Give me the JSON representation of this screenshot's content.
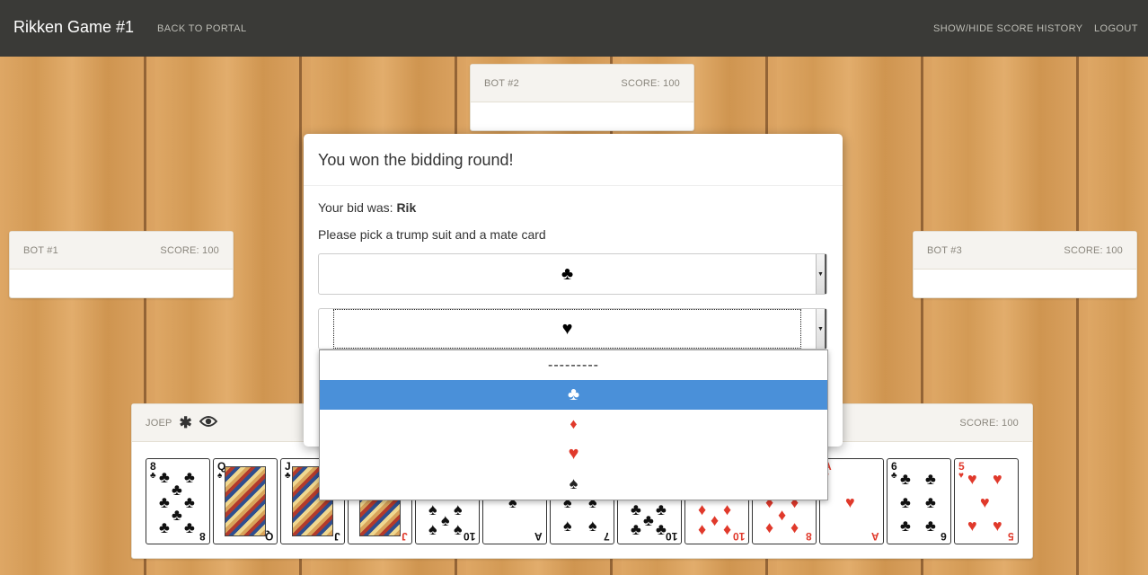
{
  "navbar": {
    "title": "Rikken Game #1",
    "back_label": "BACK TO PORTAL",
    "history_label": "SHOW/HIDE SCORE HISTORY",
    "logout_label": "LOGOUT"
  },
  "bots": {
    "bot1": {
      "name": "BOT #1",
      "score": "SCORE: 100"
    },
    "bot2": {
      "name": "BOT #2",
      "score": "SCORE: 100"
    },
    "bot3": {
      "name": "BOT #3",
      "score": "SCORE: 100"
    }
  },
  "player": {
    "name": "JOEP",
    "score": "SCORE: 100",
    "icons": [
      "asterisk-icon",
      "eye-icon"
    ]
  },
  "modal": {
    "title": "You won the bidding round!",
    "bid_prefix": "Your bid was: ",
    "bid_value": "Rik",
    "instruction": "Please pick a trump suit and a mate card",
    "trump_value": "♣",
    "mate_value": "♥"
  },
  "dropdown": {
    "options": [
      "---------",
      "♣",
      "♦",
      "♥",
      "♠"
    ],
    "selected_index": 1
  },
  "hand": [
    {
      "rank": "8",
      "suit": "♣",
      "color": "black"
    },
    {
      "rank": "Q",
      "suit": "♠",
      "color": "black"
    },
    {
      "rank": "J",
      "suit": "♣",
      "color": "black"
    },
    {
      "rank": "J",
      "suit": "♦",
      "color": "red"
    },
    {
      "rank": "10",
      "suit": "♠",
      "color": "black"
    },
    {
      "rank": "A",
      "suit": "♠",
      "color": "black"
    },
    {
      "rank": "7",
      "suit": "♠",
      "color": "black"
    },
    {
      "rank": "10",
      "suit": "♣",
      "color": "black"
    },
    {
      "rank": "10",
      "suit": "♦",
      "color": "red"
    },
    {
      "rank": "8",
      "suit": "♦",
      "color": "red"
    },
    {
      "rank": "A",
      "suit": "♥",
      "color": "red"
    },
    {
      "rank": "6",
      "suit": "♣",
      "color": "black"
    },
    {
      "rank": "5",
      "suit": "♥",
      "color": "red"
    }
  ],
  "colors": {
    "navbar": "#3a3a37",
    "selected_option": "#4a90d9",
    "red_suit": "#e0392b"
  }
}
